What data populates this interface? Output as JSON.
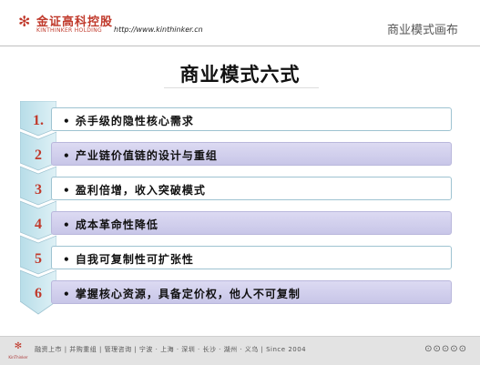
{
  "header": {
    "logo_cn": "金证高科控股",
    "logo_en": "KINTHINKER HOLDING",
    "url": "http://www.kinthinker.cn",
    "title": "商业模式画布"
  },
  "slide": {
    "title": "商业模式六式",
    "items": [
      {
        "number": "1.",
        "text": "•  杀手级的隐性核心需求"
      },
      {
        "number": "2",
        "text": "•  产业链价值链的设计与重组"
      },
      {
        "number": "3",
        "text": "•  盈利倍增，收入突破模式"
      },
      {
        "number": "4",
        "text": "•  成本革命性降低"
      },
      {
        "number": "5",
        "text": "•  自我可复制性可扩张性"
      },
      {
        "number": "6",
        "text": "•  掌握核心资源，具备定价权，他人不可复制"
      }
    ]
  },
  "footer": {
    "logo_label": "KinThinker",
    "text": "融资上市 | 并购重组 | 管理咨询 | 宁波 · 上海 · 深圳 · 长沙 · 湖州 · 义乌 | Since 2004",
    "dots": "⊙⊙⊙⊙⊙"
  },
  "colors": {
    "accent": "#c0392b",
    "chevron": "#c8e6ee",
    "bar_border": "#9ec3d1",
    "bar_lavender": "#d6d4ef"
  }
}
